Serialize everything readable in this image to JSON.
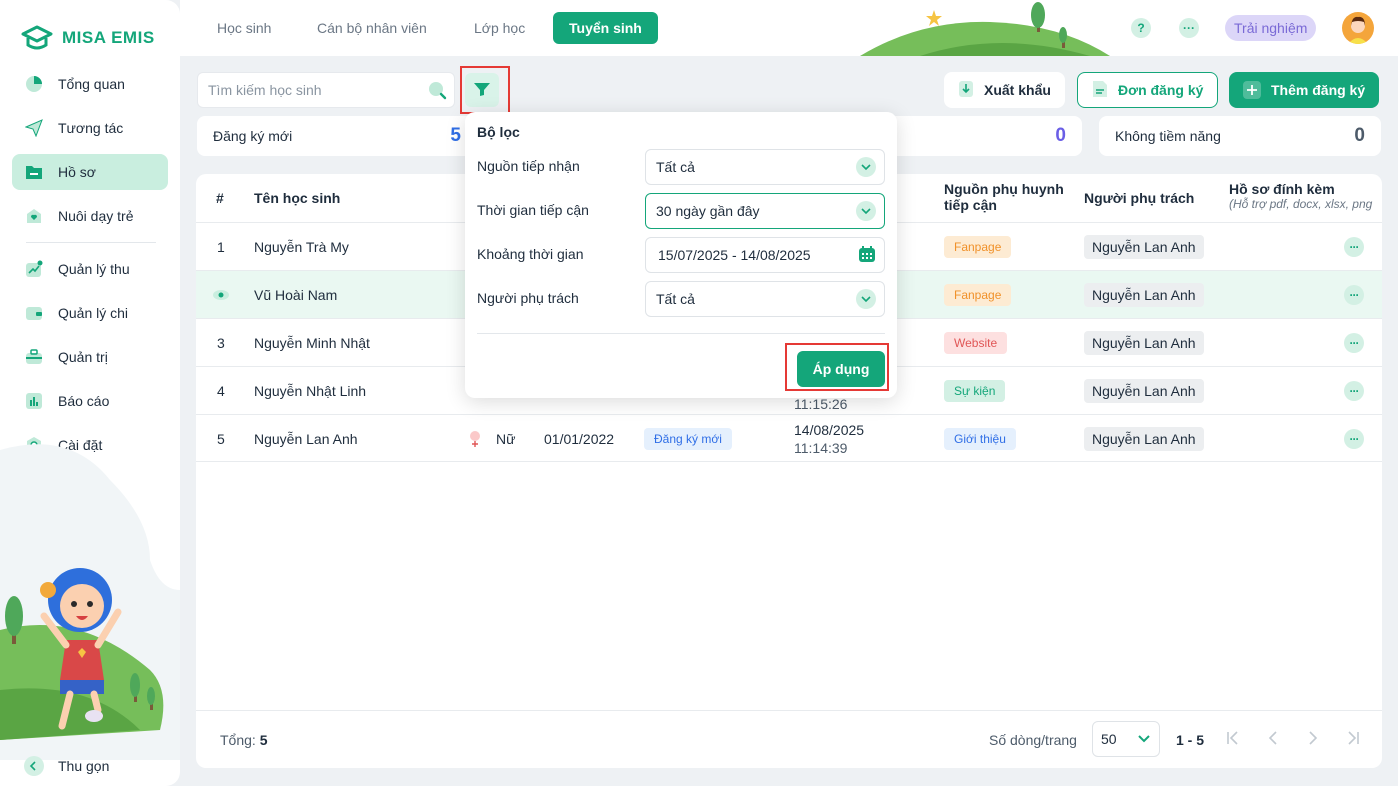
{
  "brand": {
    "name": "MISA EMIS"
  },
  "sidebar": {
    "items": [
      {
        "label": "Tổng quan",
        "icon": "pie-chart-icon"
      },
      {
        "label": "Tương tác",
        "icon": "send-icon"
      },
      {
        "label": "Hồ sơ",
        "icon": "folder-icon"
      },
      {
        "label": "Nuôi dạy trẻ",
        "icon": "heart-icon"
      },
      {
        "label": "Quản lý thu",
        "icon": "chart-up-icon"
      },
      {
        "label": "Quản lý chi",
        "icon": "wallet-icon"
      },
      {
        "label": "Quản trị",
        "icon": "briefcase-icon"
      },
      {
        "label": "Báo cáo",
        "icon": "bar-chart-icon"
      },
      {
        "label": "Cài đặt",
        "icon": "gear-icon"
      }
    ],
    "collapse_label": "Thu gọn"
  },
  "topnav": {
    "tabs": [
      "Học sinh",
      "Cán bộ nhân viên",
      "Lớp học",
      "Tuyển sinh"
    ],
    "help": "?",
    "more": "···",
    "trial": "Trải nghiệm"
  },
  "toolbar": {
    "search_placeholder": "Tìm kiếm học sinh",
    "export_label": "Xuất khẩu",
    "form_label": "Đơn đăng ký",
    "add_label": "Thêm đăng ký"
  },
  "stats": [
    {
      "label": "Đăng ký mới",
      "value": "5"
    },
    {
      "label": "",
      "value": "0"
    },
    {
      "label": "Không tiềm năng",
      "value": "0"
    }
  ],
  "table": {
    "headers": {
      "index": "#",
      "name": "Tên học sinh",
      "source_1": "Nguồn phụ huynh",
      "source_2": "tiếp cận",
      "owner": "Người phụ trách",
      "attach": "Hồ sơ đính kèm",
      "attach_note": "(Hỗ trợ pdf, docx, xlsx, png"
    },
    "rows": [
      {
        "index": "1",
        "name": "Nguyễn Trà My",
        "source": "Fanpage",
        "owner": "Nguyễn Lan Anh"
      },
      {
        "index": "",
        "name": "Vũ Hoài Nam",
        "source": "Fanpage",
        "owner": "Nguyễn Lan Anh"
      },
      {
        "index": "3",
        "name": "Nguyễn Minh Nhật",
        "source": "Website",
        "owner": "Nguyễn Lan Anh"
      },
      {
        "index": "4",
        "name": "Nguyễn Nhật Linh",
        "source": "Sự kiện",
        "owner": "Nguyễn Lan Anh",
        "time": "11:15:26"
      },
      {
        "index": "5",
        "name": "Nguyễn Lan Anh",
        "gender": "Nữ",
        "dob": "01/01/2022",
        "status": "Đăng ký mới",
        "date": "14/08/2025",
        "time": "11:14:39",
        "source": "Giới thiệu",
        "owner": "Nguyễn Lan Anh"
      }
    ]
  },
  "filter": {
    "title": "Bộ lọc",
    "fields": [
      {
        "label": "Nguồn tiếp nhận",
        "value": "Tất cả"
      },
      {
        "label": "Thời gian tiếp cận",
        "value": "30 ngày gần đây"
      },
      {
        "label": "Khoảng thời gian",
        "value": "15/07/2025 - 14/08/2025"
      },
      {
        "label": "Người phụ trách",
        "value": "Tất cả"
      }
    ],
    "apply_label": "Áp dụng"
  },
  "footer": {
    "total_label": "Tổng:",
    "total_value": "5",
    "rows_per_page_label": "Số dòng/trang",
    "rows_per_page": "50",
    "range": "1 - 5"
  },
  "colors": {
    "accent": "#14a67a",
    "highlight": "#e53935"
  }
}
